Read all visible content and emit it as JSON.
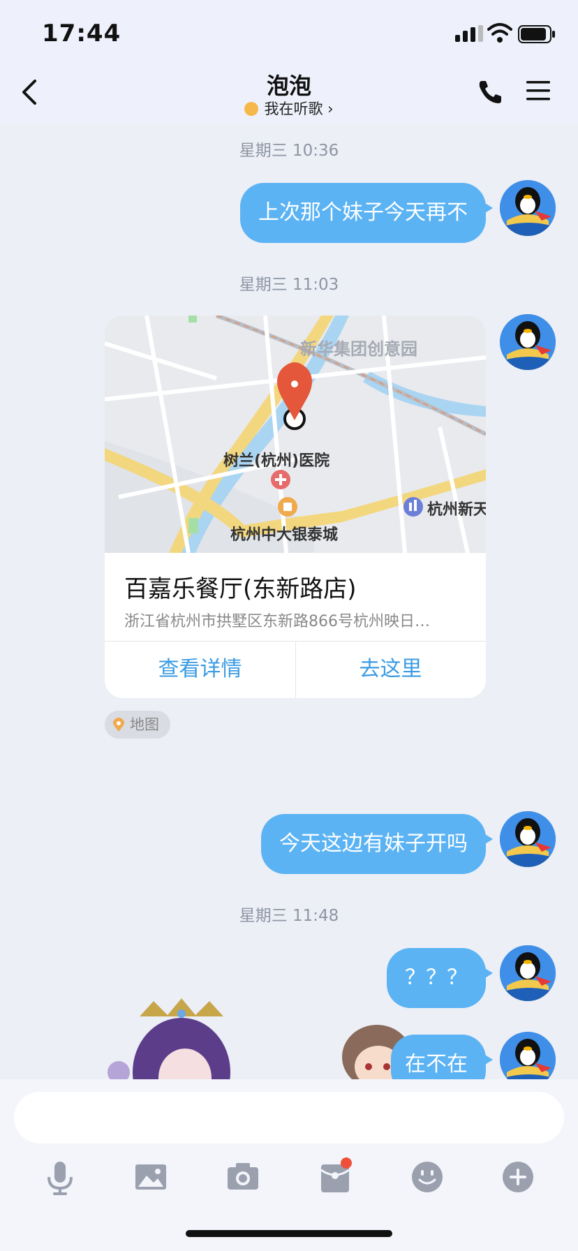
{
  "status_bar": {
    "time": "17:44"
  },
  "header": {
    "title": "泡泡",
    "subtitle": "我在听歌 ›"
  },
  "messages": {
    "ts1": "星期三 10:36",
    "msg1": "上次那个妹子今天再不",
    "ts2": "星期三 11:03",
    "location_card": {
      "map_labels": {
        "park": "新华集团创意园",
        "hospital": "树兰(杭州)医院",
        "mall": "杭州中大银泰城",
        "right": "杭州新天"
      },
      "name": "百嘉乐餐厅(东新路店)",
      "address": "浙江省杭州市拱墅区东新路866号杭州映日…",
      "btn_details": "查看详情",
      "btn_go": "去这里"
    },
    "map_tag": "地图",
    "msg2": "今天这边有妹子开吗",
    "ts3": "星期三 11:48",
    "msg3": "？？？",
    "msg4": "在不在"
  },
  "toolbar": {
    "icons": [
      "mic-icon",
      "image-icon",
      "camera-icon",
      "red-packet-icon",
      "emoji-icon",
      "plus-icon"
    ]
  },
  "colors": {
    "bubble": "#5bb3f4",
    "link": "#3a9be3",
    "pin": "#e4573a"
  }
}
